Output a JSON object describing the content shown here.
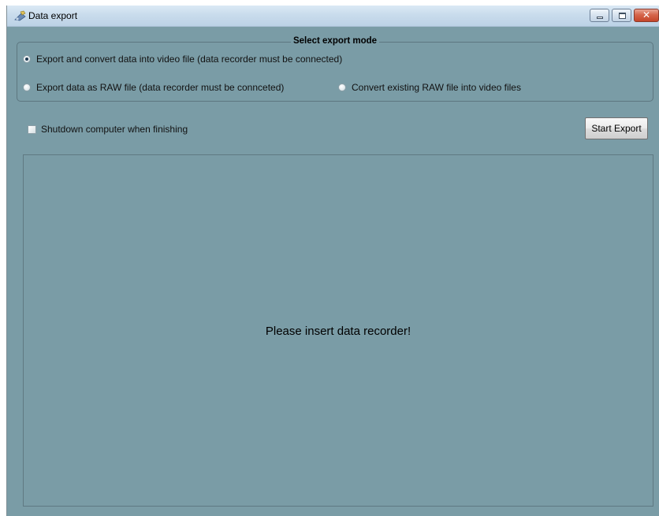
{
  "window": {
    "title": "Data export",
    "icon": "data-export-icon",
    "controls": {
      "minimize": "minimize-icon",
      "maximize": "maximize-icon",
      "close": "close-icon"
    }
  },
  "export_mode": {
    "title": "Select export mode",
    "options": [
      {
        "label": "Export and convert data into video file (data recorder must be connected)",
        "selected": true
      },
      {
        "label": "Export data as RAW file (data recorder must be connceted)",
        "selected": false
      },
      {
        "label": "Convert existing RAW file into video files",
        "selected": false
      }
    ]
  },
  "shutdown": {
    "label": "Shutdown computer when finishing",
    "checked": false
  },
  "start_button": {
    "label": "Start Export"
  },
  "status": {
    "message": "Please insert data recorder!"
  },
  "colors": {
    "background": "#7a9ca6",
    "titlebar": "#c9dcec",
    "close_button": "#c5452a"
  }
}
